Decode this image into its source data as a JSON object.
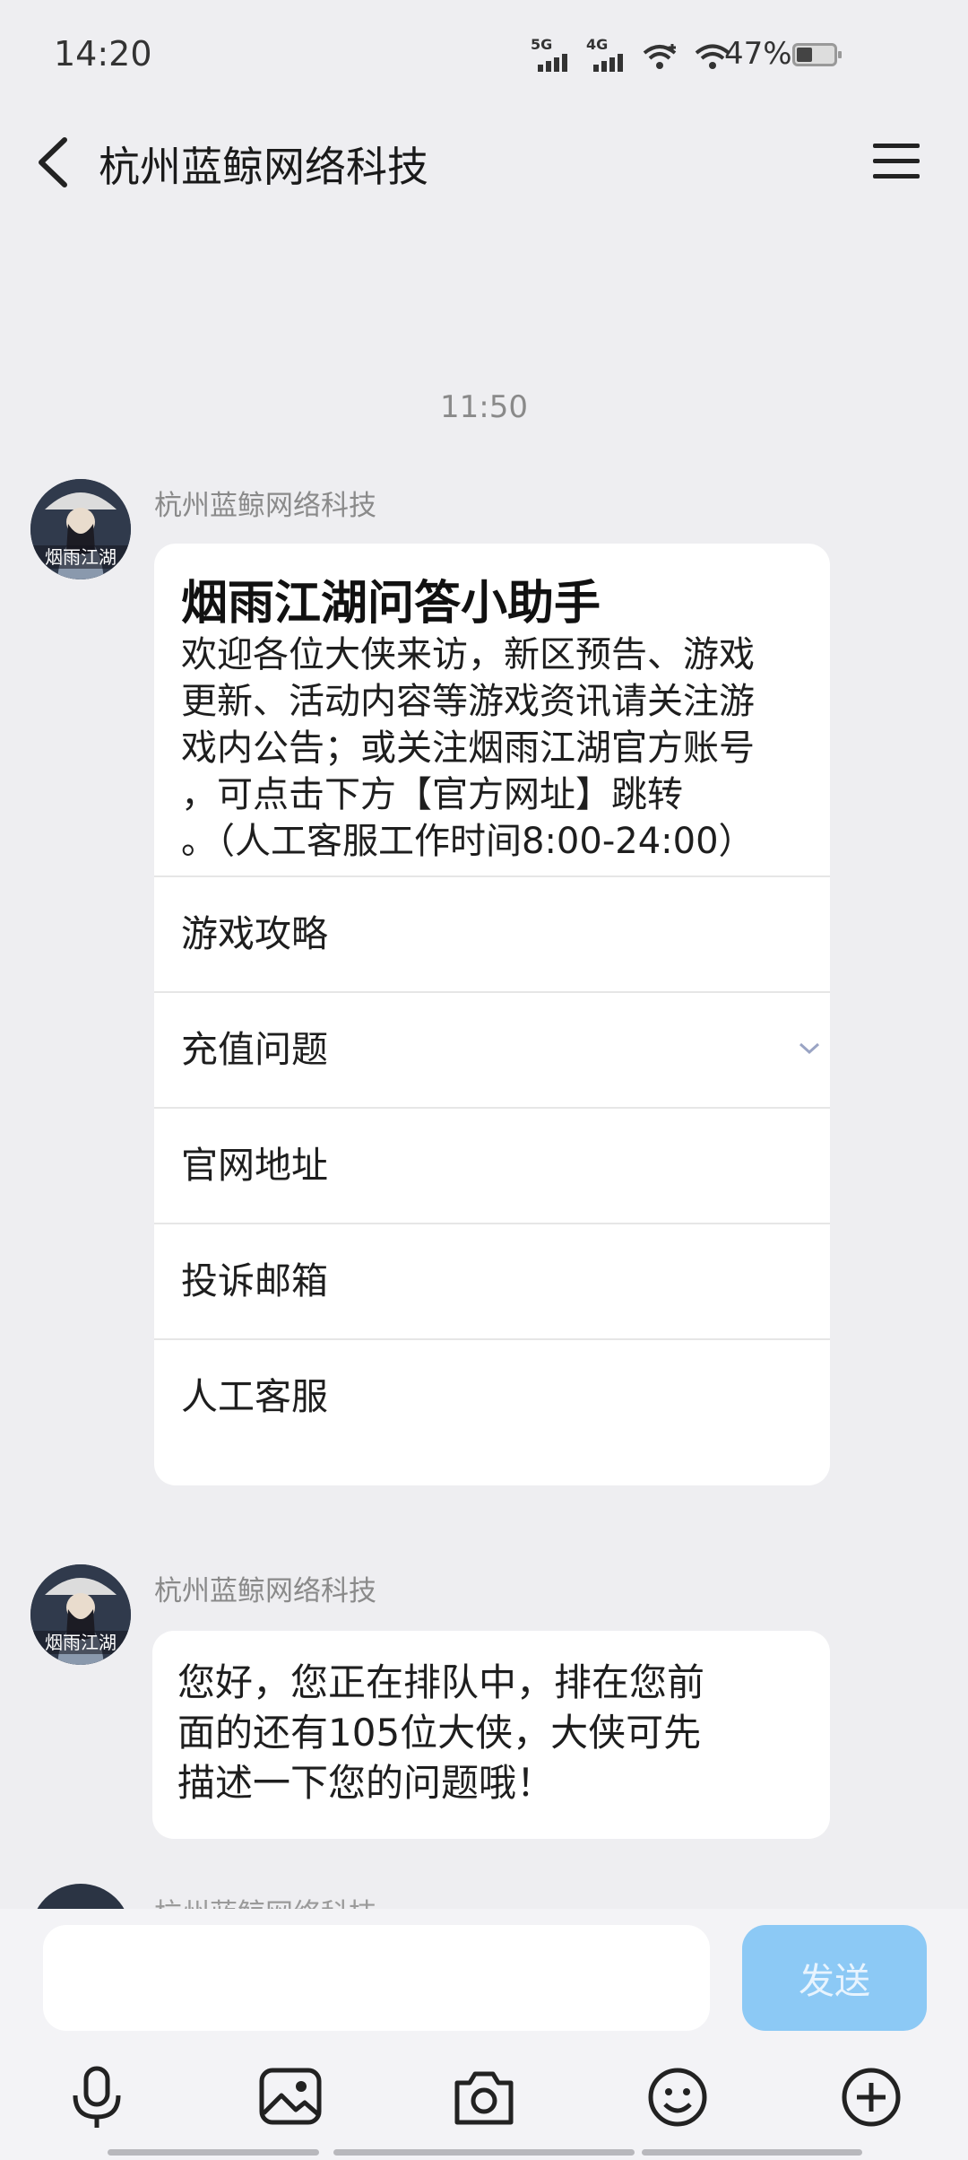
{
  "status_bar": {
    "time": "14:20",
    "signal_1": "5G",
    "signal_2": "4G",
    "battery": "47%"
  },
  "header": {
    "title": "杭州蓝鲸网络科技"
  },
  "chat": {
    "timestamp": "11:50",
    "messages": [
      {
        "sender": "杭州蓝鲸网络科技",
        "card_title": "烟雨江湖问答小助手",
        "card_lines": [
          "欢迎各位大侠来访，新区预告、游戏",
          "更新、活动内容等游戏资讯请关注游",
          "戏内公告；或关注烟雨江湖官方账号",
          "，可点击下方【官方网址】跳转",
          "。（人工客服工作时间8:00-24:00）"
        ],
        "options": [
          "游戏攻略",
          "充值问题",
          "官网地址",
          "投诉邮箱",
          "人工客服"
        ]
      },
      {
        "sender": "杭州蓝鲸网络科技",
        "lines": [
          "您好，您正在排队中，排在您前",
          "面的还有105位大侠，大侠可先",
          "描述一下您的问题哦！"
        ]
      },
      {
        "sender": "杭州蓝鲸网络科技"
      }
    ]
  },
  "input_bar": {
    "placeholder": "",
    "send_label": "发送",
    "send_color": "#8cc9f5"
  },
  "toolbar": {
    "icons": [
      "microphone-icon",
      "image-icon",
      "camera-icon",
      "emoji-icon",
      "plus-icon"
    ]
  },
  "avatar_text": "烟雨江湖"
}
